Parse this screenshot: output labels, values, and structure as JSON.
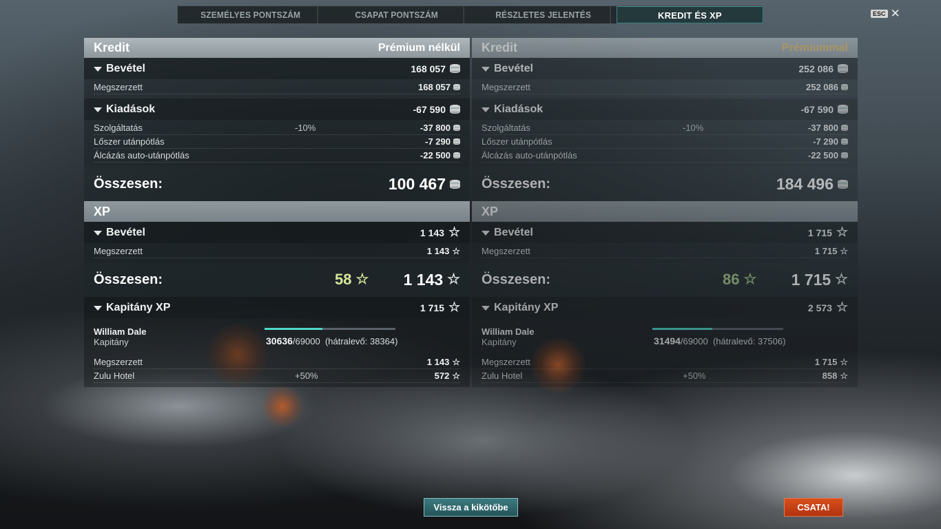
{
  "tabs": [
    "SZEMÉLYES PONTSZÁM",
    "CSAPAT PONTSZÁM",
    "RÉSZLETES JELENTÉS",
    "KREDIT ÉS XP"
  ],
  "esc": {
    "key": "ESC",
    "close": "✕"
  },
  "icons": {
    "credit": "credit-coin-icon",
    "xp": "star-icon"
  },
  "colors": {
    "active_tab": "#24393c",
    "accent_teal": "#4ed8c8",
    "premium_label": "#e2b96a",
    "battle_button": "#c43e15",
    "bonus_green": "#d7e69a"
  },
  "left": {
    "kredit_title": "Kredit",
    "mode": "Prémium nélkül",
    "income_label": "Bevétel",
    "income_value": "168 057",
    "earned_label": "Megszerzett",
    "earned_value": "168 057",
    "expenses_label": "Kiadások",
    "expenses_value": "-67 590",
    "service_label": "Szolgáltatás",
    "service_pct": "-10%",
    "service_value": "-37 800",
    "ammo_label": "Lőszer utánpótlás",
    "ammo_value": "-7 290",
    "camo_label": "Álcázás auto-utánpótlás",
    "camo_value": "-22 500",
    "total_label": "Összesen:",
    "total_value": "100 467",
    "xp_title": "XP",
    "xp_income_label": "Bevétel",
    "xp_income_value": "1 143",
    "xp_earned_label": "Megszerzett",
    "xp_earned_value": "1 143",
    "xp_total_label": "Összesen:",
    "xp_bonus": "58",
    "xp_total_value": "1 143",
    "cap_label": "Kapitány XP",
    "cap_value": "1 715",
    "cap_name": "William Dale",
    "cap_rank": "Kapitány",
    "cap_progress": 0.444,
    "cap_cur": "30636",
    "cap_max": "/69000",
    "cap_left": "(hátralevő: 38364)",
    "cap_earned_label": "Megszerzett",
    "cap_earned_value": "1 143",
    "cap_zulu_label": "Zulu Hotel",
    "cap_zulu_pct": "+50%",
    "cap_zulu_value": "572"
  },
  "right": {
    "kredit_title": "Kredit",
    "mode": "Prémiummal",
    "income_label": "Bevétel",
    "income_value": "252 086",
    "earned_label": "Megszerzett",
    "earned_value": "252 086",
    "expenses_label": "Kiadások",
    "expenses_value": "-67 590",
    "service_label": "Szolgáltatás",
    "service_pct": "-10%",
    "service_value": "-37 800",
    "ammo_label": "Lőszer utánpótlás",
    "ammo_value": "-7 290",
    "camo_label": "Álcázás auto-utánpótlás",
    "camo_value": "-22 500",
    "total_label": "Összesen:",
    "total_value": "184 496",
    "xp_title": "XP",
    "xp_income_label": "Bevétel",
    "xp_income_value": "1 715",
    "xp_earned_label": "Megszerzett",
    "xp_earned_value": "1 715",
    "xp_total_label": "Összesen:",
    "xp_bonus": "86",
    "xp_total_value": "1 715",
    "cap_label": "Kapitány XP",
    "cap_value": "2 573",
    "cap_name": "William Dale",
    "cap_rank": "Kapitány",
    "cap_progress": 0.456,
    "cap_cur": "31494",
    "cap_max": "/69000",
    "cap_left": "(hátralevő: 37506)",
    "cap_earned_label": "Megszerzett",
    "cap_earned_value": "1 715",
    "cap_zulu_label": "Zulu Hotel",
    "cap_zulu_pct": "+50%",
    "cap_zulu_value": "858"
  },
  "buttons": {
    "back": "Vissza a kikötőbe",
    "battle": "CSATA!"
  }
}
